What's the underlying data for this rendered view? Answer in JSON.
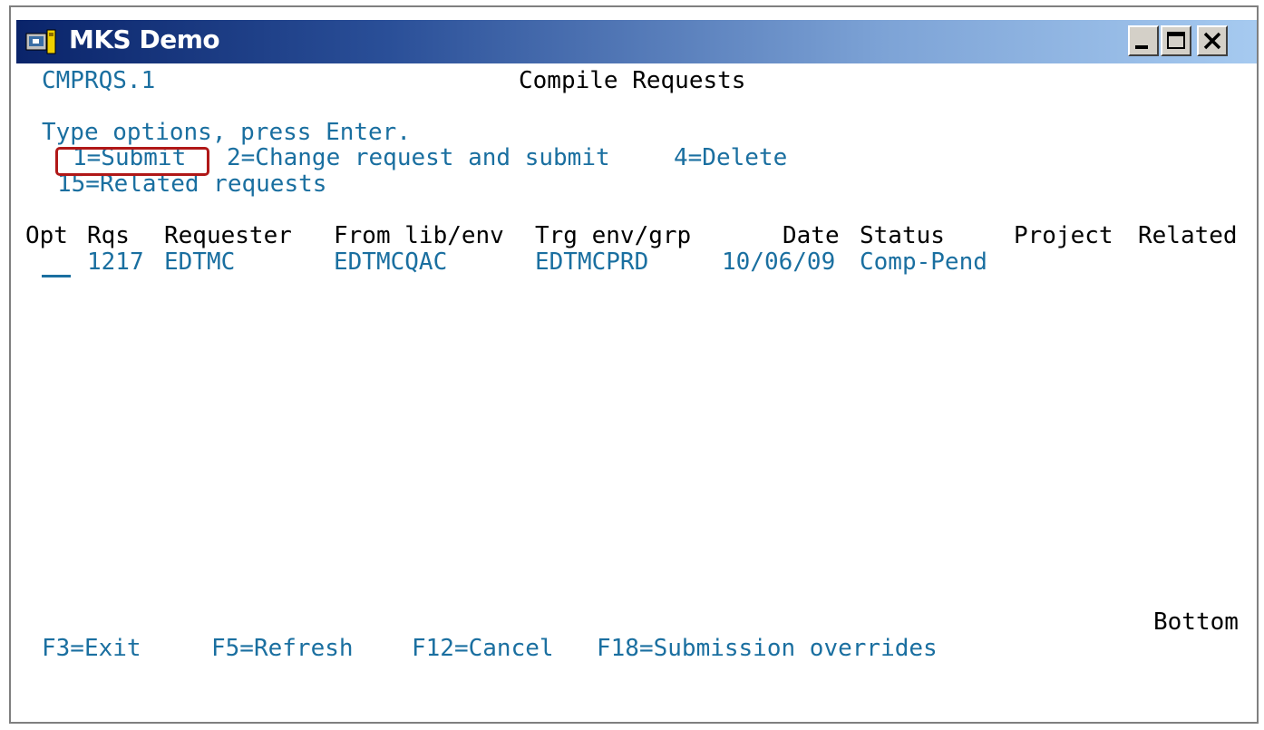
{
  "window": {
    "title": "MKS Demo",
    "controls": [
      "minimize",
      "maximize",
      "close"
    ]
  },
  "screen": {
    "program_id": "CMPRQS.1",
    "heading": "Compile Requests",
    "instructions": "Type options, press Enter.",
    "options": {
      "submit": "1=Submit",
      "change_submit": "2=Change request and submit",
      "delete": "4=Delete",
      "related": "15=Related requests"
    },
    "columns": {
      "opt": "Opt",
      "rqs": "Rqs",
      "requester": "Requester",
      "from": "From lib/env",
      "target": "Trg env/grp",
      "date": "Date",
      "status": "Status",
      "project": "Project",
      "related": "Related"
    },
    "rows": [
      {
        "opt": "",
        "rqs": "1217",
        "requester": "EDTMC",
        "from": "EDTMCQAC",
        "target": "EDTMCPRD",
        "date": "10/06/09",
        "status": "Comp-Pend",
        "project": "",
        "related": ""
      }
    ],
    "position_indicator": "Bottom",
    "function_keys": {
      "exit": "F3=Exit",
      "refresh": "F5=Refresh",
      "cancel": "F12=Cancel",
      "overrides": "F18=Submission overrides"
    }
  },
  "colors": {
    "field_text": "#1a6fa0",
    "label_text": "#000000",
    "highlight_box": "#b01818"
  }
}
